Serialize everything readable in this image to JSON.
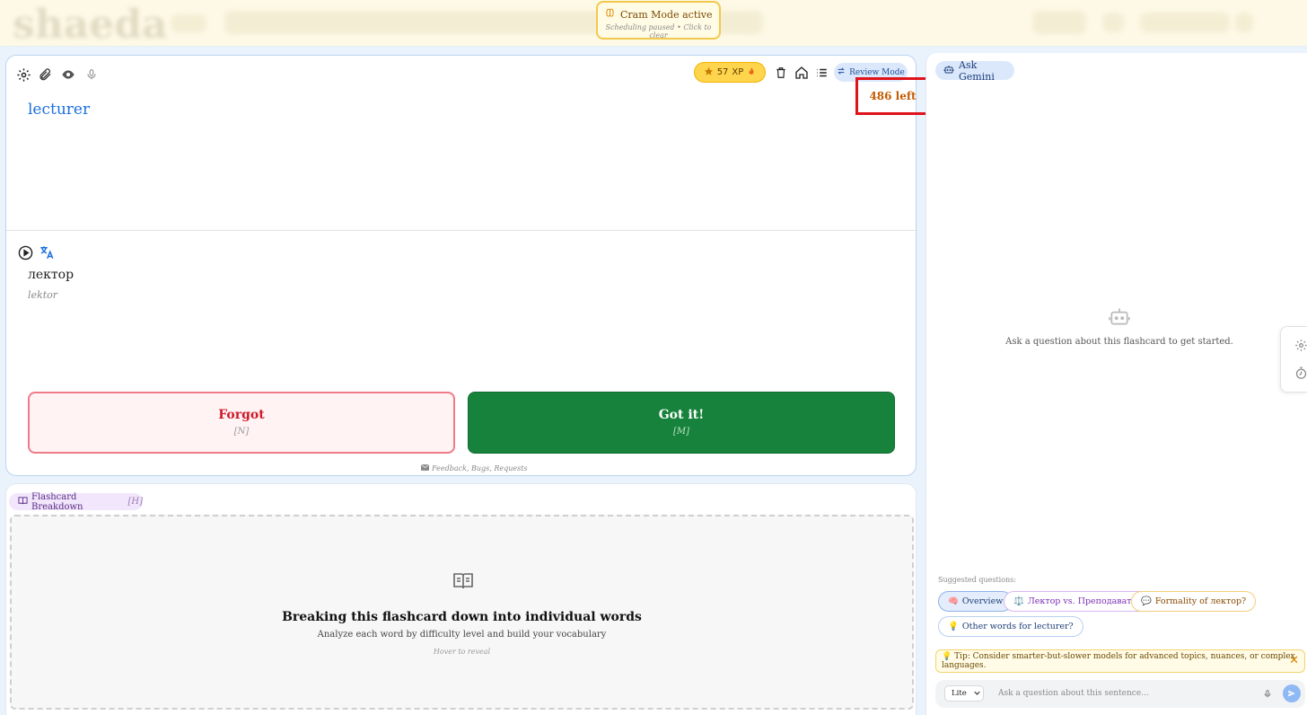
{
  "header": {
    "logo_text": "shaeda",
    "cram_title": "Cram Mode active",
    "cram_subtitle": "Scheduling paused • Click to clear"
  },
  "card": {
    "xp_value": "57",
    "xp_label": "XP",
    "review_mode_label": "Review Mode",
    "remaining_label": "486 left",
    "term": "lecturer",
    "translation": "лектор",
    "transliteration": "lektor",
    "forgot_label": "Forgot",
    "forgot_key": "[N]",
    "got_label": "Got it!",
    "got_key": "[M]",
    "feedback_label": "Feedback, Bugs, Requests"
  },
  "breakdown": {
    "pill_label": "Flashcard Breakdown",
    "pill_key": "[H]",
    "title": "Breaking this flashcard down into individual words",
    "subtitle": "Analyze each word by difficulty level and build your vocabulary",
    "hover_hint": "Hover to reveal"
  },
  "assistant": {
    "ask_label": "Ask Gemini",
    "empty_hint": "Ask a question about this flashcard to get started.",
    "suggested_label": "Suggested questions:",
    "chips": [
      {
        "emoji": "🧠",
        "label": "Overview"
      },
      {
        "emoji": "⚖️",
        "label": "Лектор vs. Преподаватель?"
      },
      {
        "emoji": "💬",
        "label": "Formality of лектор?"
      },
      {
        "emoji": "💡",
        "label": "Other words for lecturer?"
      }
    ],
    "tip": "💡 Tip: Consider smarter-but-slower models for advanced topics, nuances, or complex languages.",
    "model_value": "Lite",
    "input_placeholder": "Ask a question about this sentence..."
  },
  "icons": {
    "cram": "brain-icon",
    "card_tools": [
      "gear-icon",
      "paperclip-icon",
      "eye-icon",
      "microphone-icon"
    ],
    "card_header": [
      "star-icon",
      "fire-icon",
      "trash-icon",
      "home-icon",
      "list-icon",
      "swap-icon"
    ],
    "translation_tools": [
      "play-icon",
      "translate-icon"
    ],
    "side_tab": [
      "gear-icon",
      "timer-icon"
    ]
  },
  "colors": {
    "accent_blue": "#1a6fe0",
    "xp_gold": "#ffd54d",
    "forgot_red": "#cc1b2a",
    "got_green": "#17823b",
    "remaining_orange": "#c45a00",
    "highlight_box": "#e0121a"
  }
}
